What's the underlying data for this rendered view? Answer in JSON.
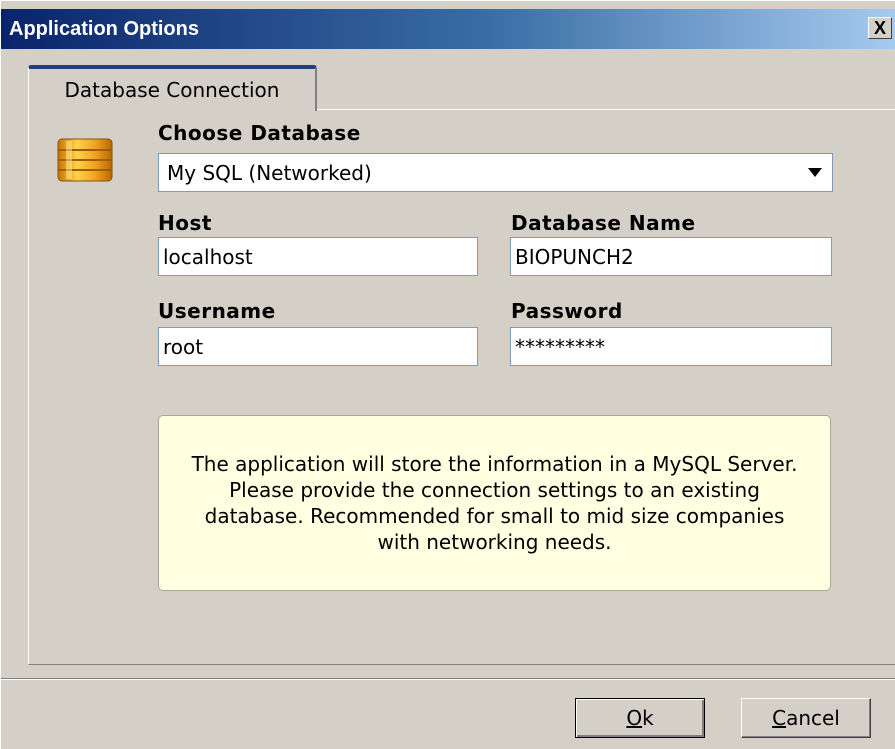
{
  "window": {
    "title": "Application Options",
    "close_glyph": "X"
  },
  "tabs": [
    {
      "label": "Database Connection",
      "active": true
    }
  ],
  "database": {
    "choose_label": "Choose Database",
    "selected": "My SQL (Networked)",
    "icon": "database-icon"
  },
  "fields": {
    "host": {
      "label": "Host",
      "value": "localhost"
    },
    "database_name": {
      "label": "Database Name",
      "value": "BIOPUNCH2"
    },
    "username": {
      "label": "Username",
      "value": "root"
    },
    "password": {
      "label": "Password",
      "value": "*********"
    }
  },
  "info_text": "The application will store the information in a MySQL Server. Please provide the connection settings to an existing database. Recommended for small to mid size companies with networking needs.",
  "buttons": {
    "ok": {
      "mnemonic": "O",
      "rest": "k"
    },
    "cancel": {
      "mnemonic": "C",
      "rest": "ancel"
    }
  },
  "colors": {
    "title_start": "#0a246a",
    "title_end": "#a6caf0",
    "dialog_bg": "#d4d0c8",
    "info_bg": "#ffffe1",
    "tab_accent": "#1f3f7f",
    "icon_orange": "#f0a020"
  }
}
